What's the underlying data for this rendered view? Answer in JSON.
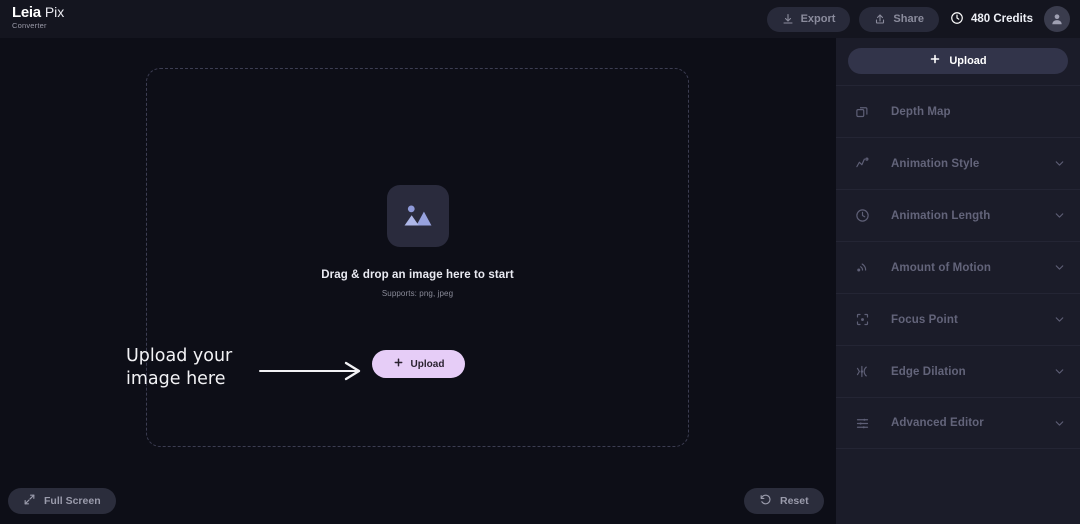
{
  "header": {
    "logo": {
      "brand_primary": "Leia",
      "brand_secondary": "Pix",
      "subtitle": "Converter"
    },
    "export_label": "Export",
    "share_label": "Share",
    "credits_label": "480 Credits"
  },
  "canvas": {
    "dropzone_title": "Drag & drop an image here to start",
    "dropzone_supports": "Supports: png, jpeg",
    "upload_button_label": "Upload",
    "annotation_text": "Upload your image here",
    "fullscreen_label": "Full Screen",
    "reset_label": "Reset"
  },
  "sidebar": {
    "upload_label": "Upload",
    "items": [
      {
        "label": "Depth Map",
        "icon": "layers-icon",
        "has_chevron": false
      },
      {
        "label": "Animation Style",
        "icon": "trend-line-icon",
        "has_chevron": true
      },
      {
        "label": "Animation Length",
        "icon": "clock-icon",
        "has_chevron": true
      },
      {
        "label": "Amount of Motion",
        "icon": "motion-waves-icon",
        "has_chevron": true
      },
      {
        "label": "Focus Point",
        "icon": "focus-brackets-icon",
        "has_chevron": true
      },
      {
        "label": "Edge Dilation",
        "icon": "edge-dilation-icon",
        "has_chevron": true
      },
      {
        "label": "Advanced Editor",
        "icon": "sliders-icon",
        "has_chevron": true
      }
    ]
  },
  "colors": {
    "canvas_bg": "#0d0e17",
    "header_bg": "#14151f",
    "sidebar_bg": "#1b1c29",
    "accent_lavender": "#e6cdf7",
    "icon_periwinkle": "#97a2de"
  }
}
